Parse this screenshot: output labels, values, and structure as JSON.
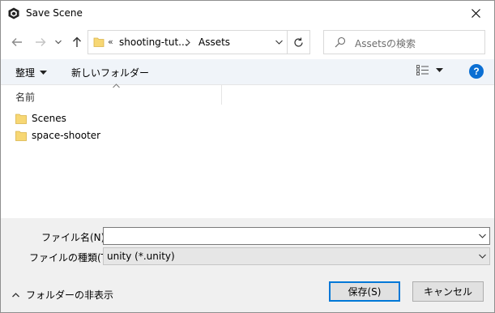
{
  "window": {
    "title": "Save Scene"
  },
  "nav": {
    "breadcrumb_prefix": "«",
    "breadcrumb_parent": "shooting-tut...",
    "breadcrumb_current": "Assets",
    "search_placeholder": "Assetsの検索"
  },
  "toolbar": {
    "organize_label": "整理",
    "new_folder_label": "新しいフォルダー"
  },
  "filelist": {
    "column_name": "名前",
    "items": [
      {
        "label": "Scenes"
      },
      {
        "label": "space-shooter"
      }
    ]
  },
  "form": {
    "filename_label": "ファイル名(N):",
    "filename_value": "",
    "filetype_label": "ファイルの種類(T):",
    "filetype_value": "unity (*.unity)"
  },
  "footer": {
    "hide_folders_label": "フォルダーの非表示",
    "save_label": "保存(S)",
    "cancel_label": "キャンセル"
  },
  "colors": {
    "accent": "#0078d7",
    "help": "#0b6fd3",
    "toolbar_bg": "#f0f4f9",
    "bottom_bg": "#f0f0f0",
    "folder": "#f7d774"
  }
}
